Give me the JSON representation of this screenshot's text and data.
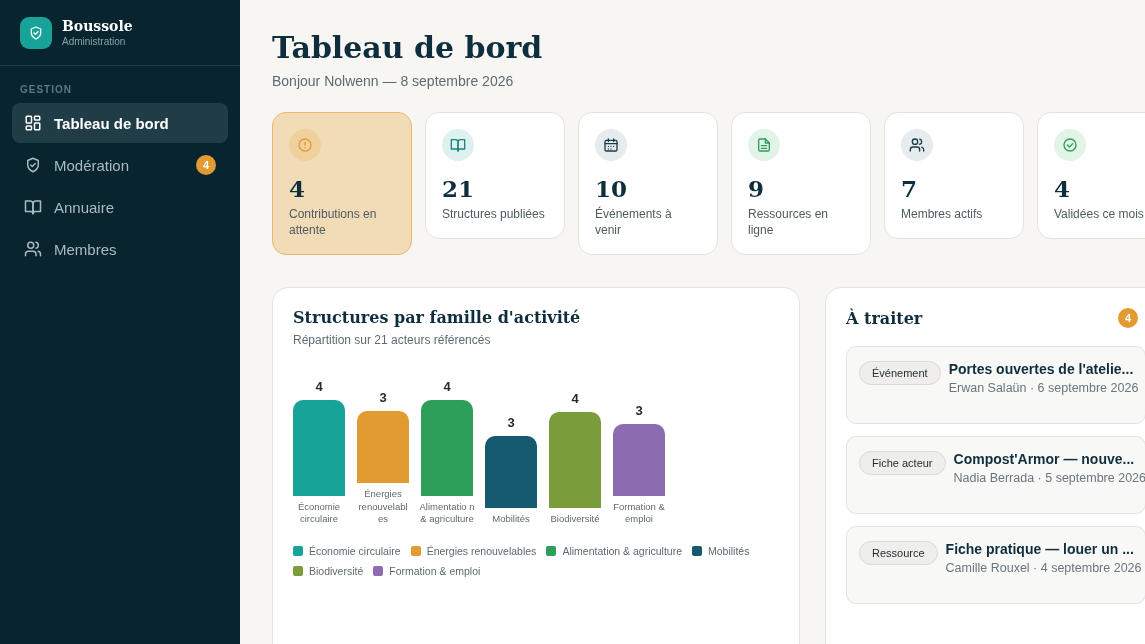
{
  "brand": {
    "name": "Boussole",
    "subtitle": "Administration"
  },
  "sidebar": {
    "section": "GESTION",
    "items": [
      {
        "label": "Tableau de bord",
        "selected": true
      },
      {
        "label": "Modération",
        "selected": false,
        "badge": "4"
      },
      {
        "label": "Annuaire",
        "selected": false
      },
      {
        "label": "Membres",
        "selected": false
      }
    ]
  },
  "header": {
    "title": "Tableau de bord",
    "subtitle": "Bonjour Nolwenn — 8 septembre 2026"
  },
  "stats": [
    {
      "value": "4",
      "label": "Contributions en attente",
      "kind": "alert",
      "highlighted": true
    },
    {
      "value": "21",
      "label": "Structures publiées",
      "kind": "book",
      "highlighted": false
    },
    {
      "value": "10",
      "label": "Événements à venir",
      "kind": "calendar",
      "highlighted": false
    },
    {
      "value": "9",
      "label": "Ressources en ligne",
      "kind": "document",
      "highlighted": false
    },
    {
      "value": "7",
      "label": "Membres actifs",
      "kind": "users",
      "highlighted": false
    },
    {
      "value": "4",
      "label": "Validées ce mois",
      "kind": "check",
      "highlighted": false
    }
  ],
  "chart_panel": {
    "title": "Structures par famille d'activité",
    "subtitle": "Répartition sur 21 acteurs référencés",
    "bars": [
      {
        "value": "4",
        "label": "Économie circulaire",
        "color": "#17a398"
      },
      {
        "value": "3",
        "label": "Énergies renouvelabl es",
        "color": "#e19b31"
      },
      {
        "value": "4",
        "label": "Alimentatio n & agriculture",
        "color": "#2e9e5b"
      },
      {
        "value": "3",
        "label": "Mobilités",
        "color": "#165a70"
      },
      {
        "value": "4",
        "label": "Biodiversité",
        "color": "#7a9c3a"
      },
      {
        "value": "3",
        "label": "Formation & emploi",
        "color": "#8c6bb0"
      }
    ],
    "legend": [
      {
        "label": "Économie circulaire",
        "color": "#17a398"
      },
      {
        "label": "Énergies renouvelables",
        "color": "#e19b31"
      },
      {
        "label": "Alimentation & agriculture",
        "color": "#2e9e5b"
      },
      {
        "label": "Mobilités",
        "color": "#165a70"
      },
      {
        "label": "Biodiversité",
        "color": "#7a9c3a"
      },
      {
        "label": "Formation & emploi",
        "color": "#8c6bb0"
      }
    ]
  },
  "todo": {
    "title": "À traiter",
    "count": "4",
    "items": [
      {
        "tag": "Événement",
        "title": "Portes ouvertes de l'atelie...",
        "meta": "Erwan Salaün · 6 septembre 2026"
      },
      {
        "tag": "Fiche acteur",
        "title": "Compost'Armor — nouve...",
        "meta": "Nadia Berrada · 5 septembre 2026"
      },
      {
        "tag": "Ressource",
        "title": "Fiche pratique — louer un ...",
        "meta": "Camille Rouxel · 4 septembre 2026"
      }
    ]
  }
}
